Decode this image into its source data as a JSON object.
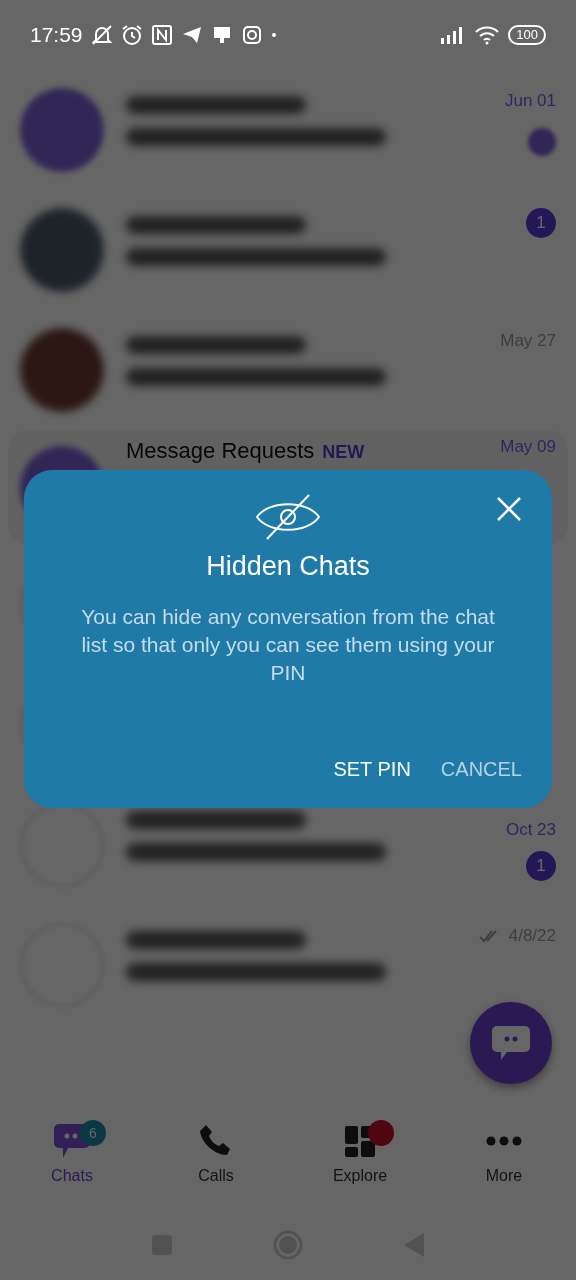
{
  "status_bar": {
    "time": "17:59",
    "battery": "100"
  },
  "chats": [
    {
      "kind": "photo",
      "date": "Jun 01",
      "date_unread": true,
      "dot": true
    },
    {
      "kind": "photo",
      "badge": "1"
    },
    {
      "kind": "photo",
      "date": "May 27",
      "date_unread": false
    },
    {
      "kind": "requests",
      "title": "Message Requests",
      "tag": "NEW",
      "date": "May 09",
      "date_unread": true
    },
    {
      "kind": "covered"
    },
    {
      "kind": "covered"
    },
    {
      "kind": "photo",
      "date": "Oct 23",
      "date_unread": true,
      "badge": "1"
    },
    {
      "kind": "photo",
      "date": "4/8/22",
      "date_unread": false,
      "read_ticks": true
    }
  ],
  "dialog": {
    "title": "Hidden Chats",
    "message": "You can hide any conversation from the chat list so that only you can see them using your PIN",
    "buttons": [
      {
        "label": "SET PIN",
        "kind": "primary"
      },
      {
        "label": "CANCEL",
        "kind": "secondary"
      }
    ]
  },
  "tabs": [
    {
      "label": "Chats",
      "selected": true,
      "badge": "6"
    },
    {
      "label": "Calls",
      "selected": false
    },
    {
      "label": "Explore",
      "selected": false,
      "dot": true
    },
    {
      "label": "More",
      "selected": false
    }
  ]
}
